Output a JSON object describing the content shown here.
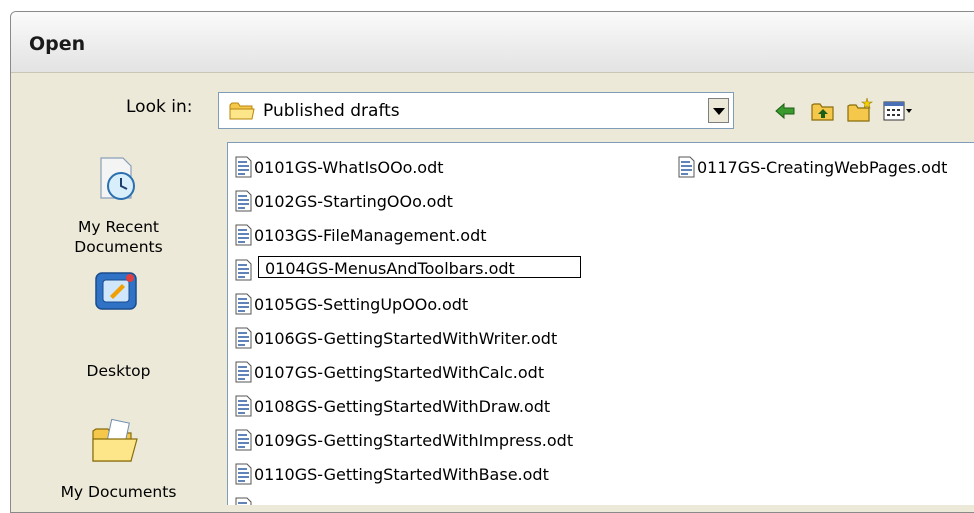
{
  "dialog": {
    "title": "Open",
    "look_in_label": "Look in:",
    "look_in_value": "Published drafts"
  },
  "toolbar": {
    "icons": [
      "back-icon",
      "up-folder-icon",
      "new-folder-icon",
      "view-menu-icon"
    ]
  },
  "places": [
    {
      "label_line1": "My Recent",
      "label_line2": "Documents",
      "icon": "recent-documents-icon"
    },
    {
      "label_line1": "Desktop",
      "label_line2": "",
      "icon": "desktop-icon"
    },
    {
      "label_line1": "My Documents",
      "label_line2": "",
      "icon": "my-documents-icon"
    }
  ],
  "files": [
    {
      "name": "0101GS-WhatIsOOo.odt"
    },
    {
      "name": "0102GS-StartingOOo.odt"
    },
    {
      "name": "0103GS-FileManagement.odt"
    },
    {
      "name": "0104GS-MenusAndToolbars.odt",
      "selected": true
    },
    {
      "name": "0105GS-SettingUpOOo.odt"
    },
    {
      "name": "0106GS-GettingStartedWithWriter.odt"
    },
    {
      "name": "0107GS-GettingStartedWithCalc.odt"
    },
    {
      "name": "0108GS-GettingStartedWithDraw.odt"
    },
    {
      "name": "0109GS-GettingStartedWithImpress.odt"
    },
    {
      "name": "0110GS-GettingStartedWithBase.odt"
    },
    {
      "name": "0117GS-CreatingWebPages.odt"
    }
  ],
  "colors": {
    "dialog_bg": "#ece9d8",
    "combo_border": "#7f9db9",
    "folder_yellow": "#f5c84c",
    "arrow_green": "#3a9a2e"
  }
}
